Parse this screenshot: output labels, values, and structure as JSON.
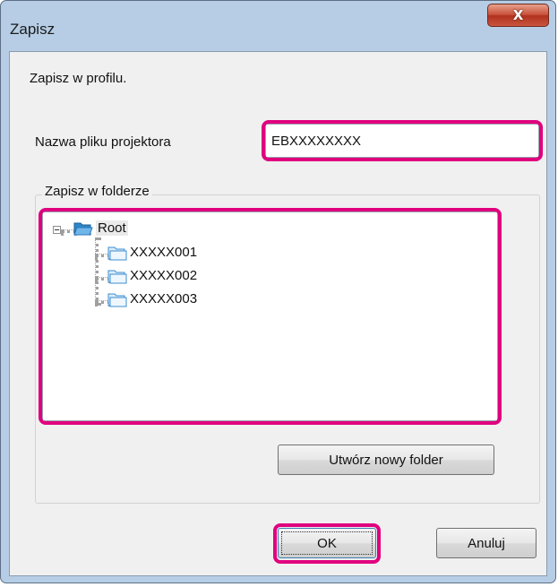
{
  "window": {
    "title": "Zapisz",
    "close_glyph": "X"
  },
  "dialog": {
    "message": "Zapisz w profilu.",
    "filename_label": "Nazwa pliku projektora",
    "filename_value": "EBXXXXXXXX",
    "group_label": "Zapisz w folderze",
    "tree": {
      "root": "Root",
      "children": [
        "XXXXX001",
        "XXXXX002",
        "XXXXX003"
      ]
    },
    "new_folder_button": "Utwórz nowy folder",
    "ok_button": "OK",
    "cancel_button": "Anuluj"
  },
  "colors": {
    "highlight": "#e0007e",
    "frame": "#b6cde5",
    "close_button": "#c8503a"
  },
  "icons": {
    "root": "open-folder-icon",
    "child": "folder-icon",
    "expander": "collapse-minus-icon"
  }
}
